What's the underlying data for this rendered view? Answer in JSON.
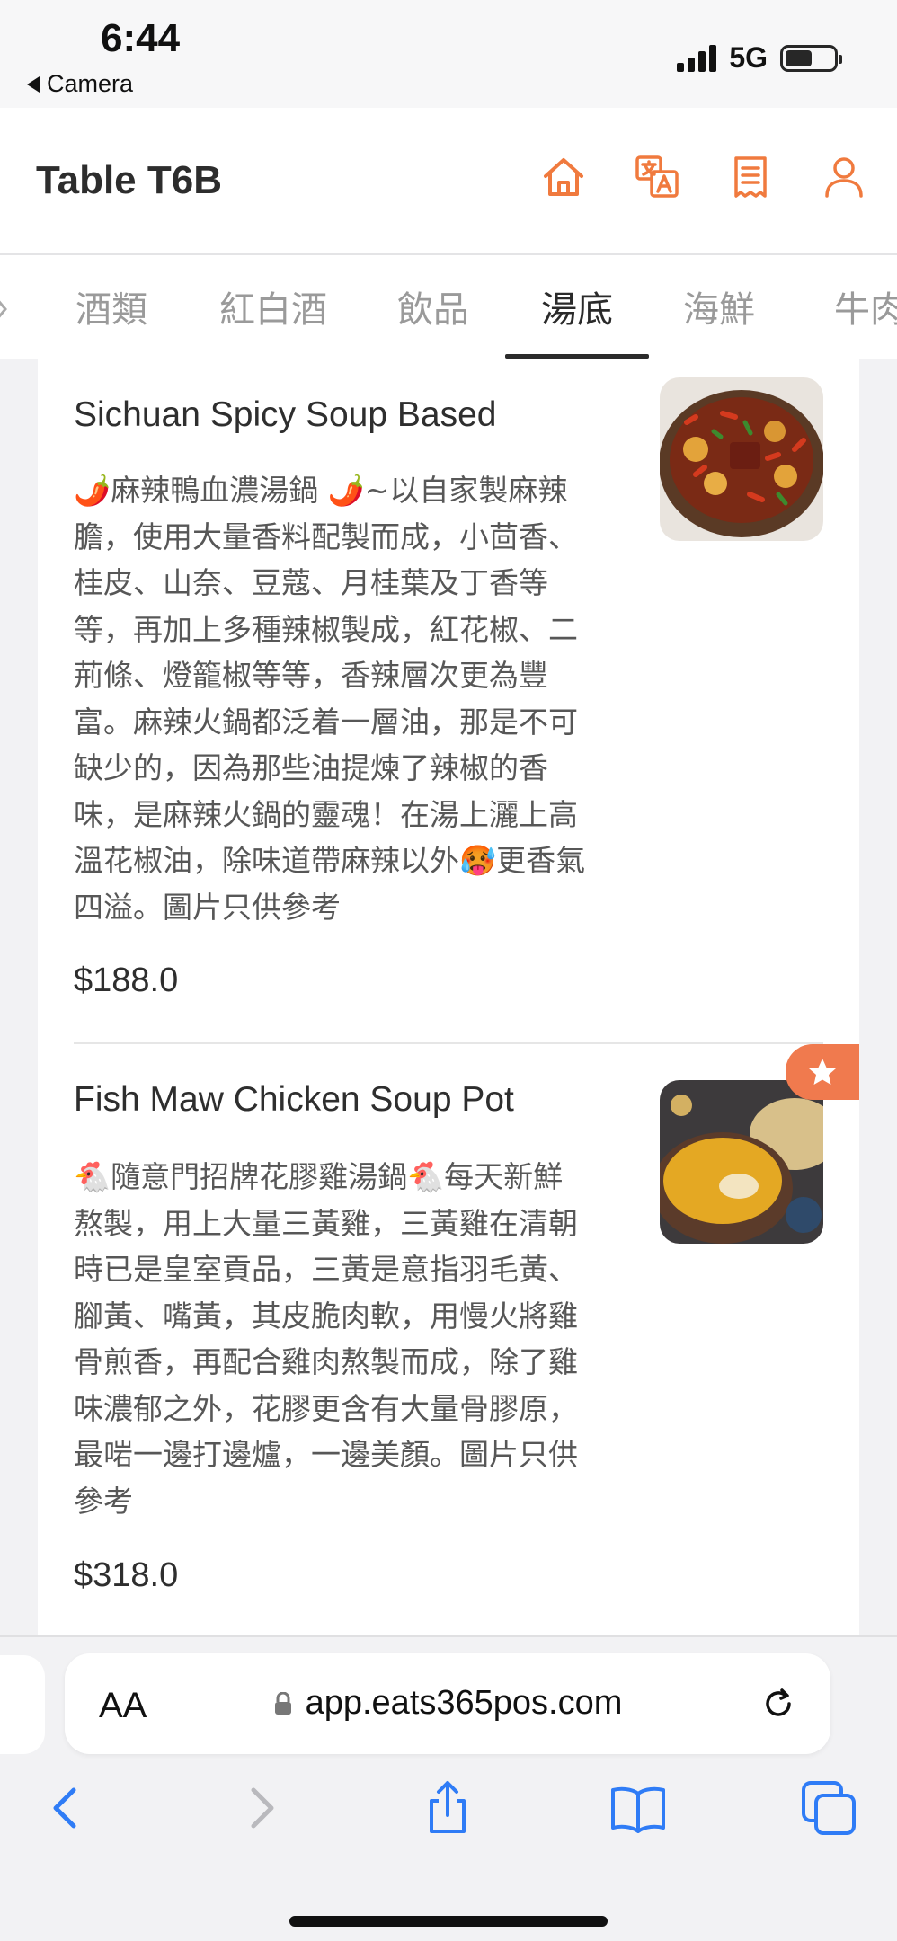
{
  "status_bar": {
    "time": "6:44",
    "back_label": "Camera",
    "network": "5G",
    "battery_level": 0.55
  },
  "header": {
    "title": "Table T6B",
    "icons": [
      "home-icon",
      "translate-icon",
      "receipt-icon",
      "user-icon"
    ],
    "accent_color": "#f07a3e"
  },
  "tabs": {
    "items": [
      "酒類",
      "紅白酒",
      "飲品",
      "湯底",
      "海鮮",
      "牛肉"
    ],
    "active": "湯底"
  },
  "menu": {
    "items": [
      {
        "name": "Sichuan Spicy Soup Based",
        "description_lines": [
          "🌶️麻辣鴨血濃湯鍋 🌶️~以自家製麻辣",
          "膽，使用大量香料配製而成，小茴香、",
          "桂皮、山奈、豆蔻、月桂葉及丁香等",
          "等，再加上多種辣椒製成，紅花椒、二",
          "荊條、燈籠椒等等，香辣層次更為豐",
          "富。麻辣火鍋都泛着一層油，那是不可",
          "缺少的，因為那些油提煉了辣椒的香",
          "味，是麻辣火鍋的靈魂！在湯上灑上高",
          "溫花椒油，除味道帶麻辣以外🥵更香氣",
          "四溢。圖片只供參考"
        ],
        "price": "$188.0"
      },
      {
        "name": "Fish Maw Chicken Soup Pot",
        "description_lines": [
          "🐔隨意門招牌花膠雞湯鍋🐔每天新鮮",
          "熬製，用上大量三黃雞，三黃雞在清朝",
          "時已是皇室貢品，三黃是意指羽毛黃、",
          "腳黃、嘴黃，其皮脆肉軟，用慢火將雞",
          "骨煎香，再配合雞肉熬製而成，除了雞",
          "味濃郁之外，花膠更含有大量骨膠原，",
          "最啱一邊打邊爐，一邊美顏。圖片只供",
          "參考"
        ],
        "price": "$318.0",
        "badge": "star-icon"
      }
    ]
  },
  "browser": {
    "text_size_label": "AA",
    "url": "app.eats365pos.com",
    "toolbar_icons": [
      "back-icon",
      "forward-icon",
      "share-icon",
      "bookmarks-icon",
      "tabs-icon"
    ]
  }
}
